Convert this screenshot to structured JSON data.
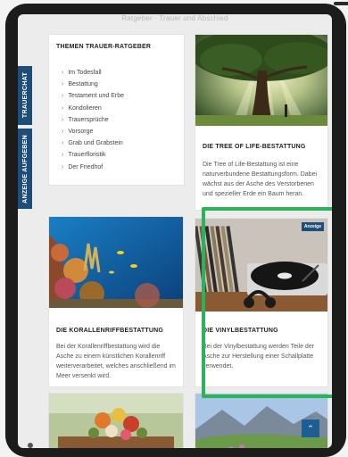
{
  "top_hint": "Ratgeber · Trauer und Abschied",
  "side_tabs": {
    "trauerchat": "TRAUERCHAT",
    "anzeige": "ANZEIGE AUFGEBEN"
  },
  "ratgeber": {
    "title": "THEMEN TRAUER-RATGEBER",
    "items": [
      "Im Todesfall",
      "Bestattung",
      "Testament und Erbe",
      "Kondolieren",
      "Trauersprüche",
      "Vorsorge",
      "Grab und Grabstein",
      "Trauerfloristik",
      "Der Friedhof"
    ]
  },
  "cards": {
    "tree": {
      "title": "DIE TREE OF LIFE-BESTATTUNG",
      "text": "Die Tree of Life-Bestattung ist eine naturverbundene Bestattungsform. Dabei wächst aus der Asche des Verstorbenen und spezieller Erde ein Baum heran."
    },
    "koralle": {
      "title": "DIE KORALLENRIFFBESTATTUNG",
      "text": "Bei der Korallenriffbestattung wird die Asche zu einem künstlichen Korallenriff weiterverarbeitet, welches anschließend im Meer versenkt wird."
    },
    "vinyl": {
      "title": "DIE VINYLBESTATTUNG",
      "text": "Bei der Vinylbestattung werden Teile der Asche zur Herstellung einer Schallplatte verwendet.",
      "badge": "Anzeige"
    }
  },
  "icons": {
    "scroll_top": "chevron-up-icon",
    "side_chevron": "chevron-down-icon"
  },
  "colors": {
    "accent_blue": "#1f4d7a",
    "highlight_green": "#2db25a"
  }
}
